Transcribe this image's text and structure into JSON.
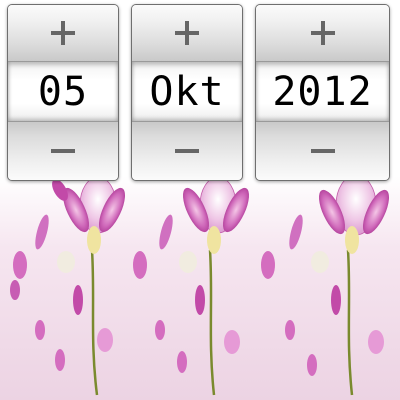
{
  "pickers": {
    "day": {
      "value": "05"
    },
    "month": {
      "value": "Okt"
    },
    "year": {
      "value": "2012"
    }
  },
  "icons": {
    "increment": "plus-icon",
    "decrement": "minus-icon"
  },
  "colors": {
    "stepper_top": "#fbfbfb",
    "stepper_bottom": "#c9c9c9",
    "value_bg": "#ffffff",
    "text": "#000000",
    "background_tint": "#ecd3e3",
    "orchid": "#c03c9c"
  }
}
